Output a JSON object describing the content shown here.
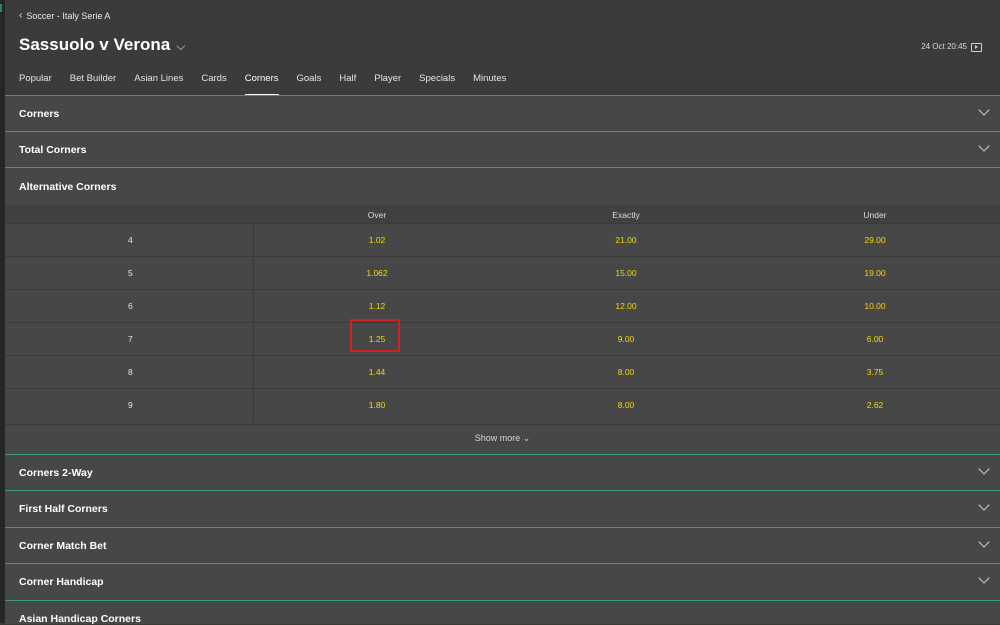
{
  "breadcrumb": {
    "back_icon": "chevron-left-icon",
    "text": "Soccer - Italy Serie A"
  },
  "event": {
    "title": "Sassuolo v Verona",
    "datetime": "24 Oct 20:45"
  },
  "tabs": [
    "Popular",
    "Bet Builder",
    "Asian Lines",
    "Cards",
    "Corners",
    "Goals",
    "Half",
    "Player",
    "Specials",
    "Minutes"
  ],
  "active_tab": "Corners",
  "markets": {
    "corners": "Corners",
    "total_corners": "Total Corners",
    "alternative_corners": "Alternative Corners",
    "corners_2way": "Corners 2-Way",
    "first_half_corners": "First Half Corners",
    "corner_match_bet": "Corner Match Bet",
    "corner_handicap": "Corner Handicap",
    "asian_handicap_corners": "Asian Handicap Corners"
  },
  "alt_table": {
    "headers": {
      "over": "Over",
      "exactly": "Exactly",
      "under": "Under"
    },
    "rows": [
      {
        "line": "4",
        "over": "1.02",
        "exactly": "21.00",
        "under": "29.00"
      },
      {
        "line": "5",
        "over": "1.062",
        "exactly": "15.00",
        "under": "19.00"
      },
      {
        "line": "6",
        "over": "1.12",
        "exactly": "12.00",
        "under": "10.00"
      },
      {
        "line": "7",
        "over": "1.25",
        "exactly": "9.00",
        "under": "6.00"
      },
      {
        "line": "8",
        "over": "1.44",
        "exactly": "8.00",
        "under": "3.75"
      },
      {
        "line": "9",
        "over": "1.80",
        "exactly": "8.00",
        "under": "2.62"
      }
    ],
    "show_more": "Show more"
  },
  "colors": {
    "accent_line": "#3c9a72",
    "odds": "#f5d90a",
    "highlight": "#d62020"
  }
}
